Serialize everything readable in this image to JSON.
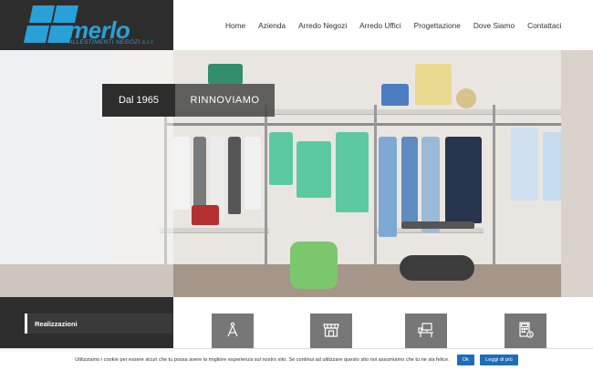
{
  "brand": {
    "name": "merlo",
    "tagline": "ALLESTIMENTI NEGOZI s.r.l.",
    "color": "#2aa0d8"
  },
  "nav": [
    {
      "label": "Home"
    },
    {
      "label": "Azienda"
    },
    {
      "label": "Arredo Negozi"
    },
    {
      "label": "Arredo Uffici"
    },
    {
      "label": "Progettazione"
    },
    {
      "label": "Dove Siamo"
    },
    {
      "label": "Contattaci"
    }
  ],
  "hero": {
    "year_label": "Dal 1965",
    "headline": "RINNOVIAMO"
  },
  "sidebar": {
    "section_label": "Realizzazioni"
  },
  "services": [
    {
      "icon": "compass-icon"
    },
    {
      "icon": "store-icon"
    },
    {
      "icon": "office-desk-icon"
    },
    {
      "icon": "calculator-icon"
    }
  ],
  "cookie": {
    "text": "Utilizziamo i cookie per essere sicuri che tu possa avere la migliore esperienza sul nostro sito. Se continui ad utilizzare questo sito noi assumiamo che tu ne sia felice.",
    "ok_label": "Ok",
    "more_label": "Leggi di più"
  }
}
